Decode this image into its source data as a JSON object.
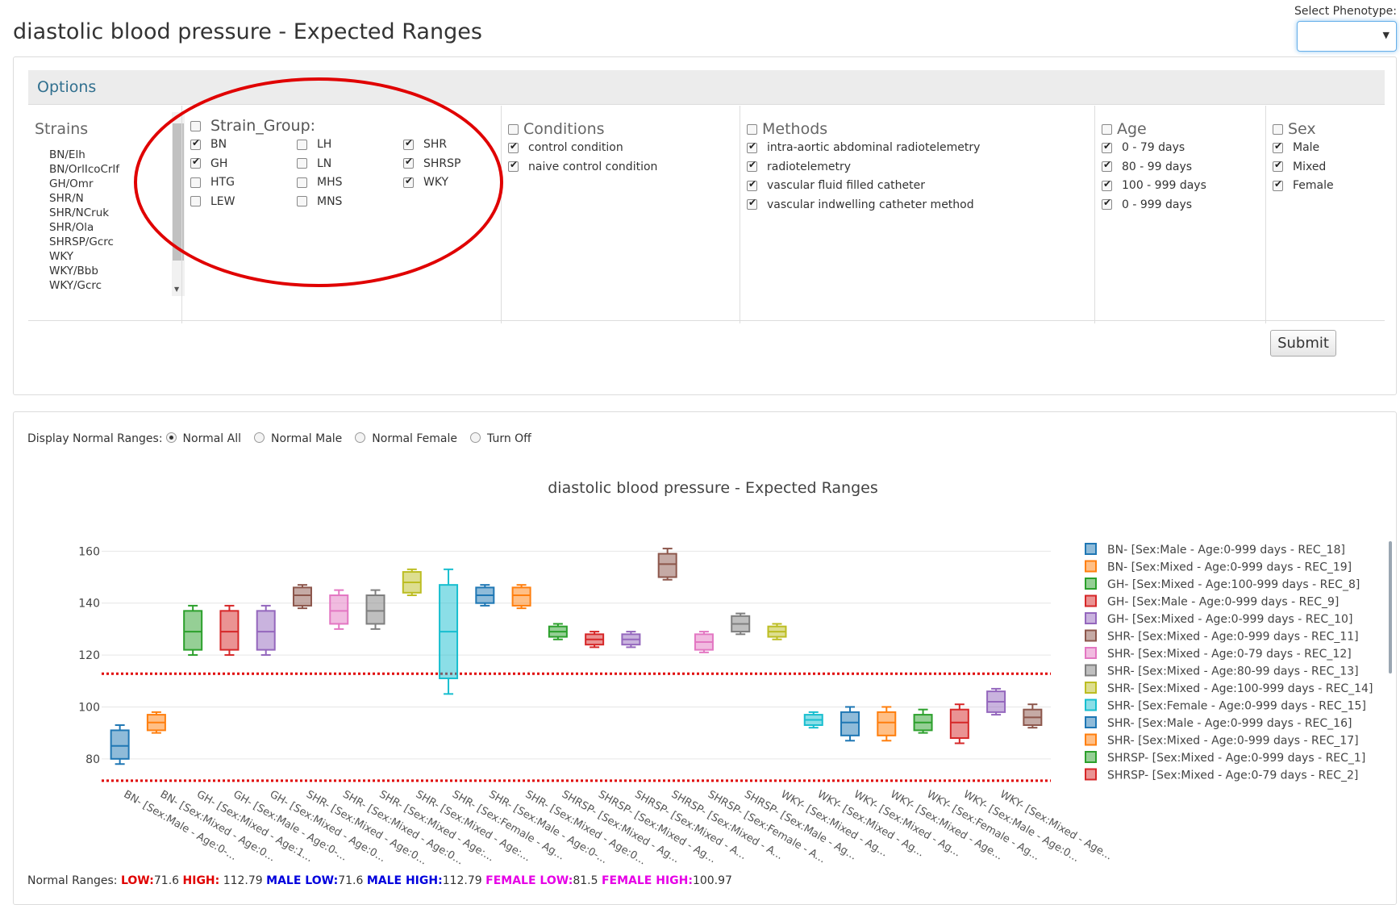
{
  "header": {
    "title": "diastolic blood pressure - Expected Ranges",
    "phenotype_label": "Select Phenotype:",
    "phenotype_value": ""
  },
  "options": {
    "title": "Options",
    "strains": {
      "title": "Strains",
      "items": [
        "BN/Elh",
        "BN/OrlIcoCrlf",
        "GH/Omr",
        "SHR/N",
        "SHR/NCruk",
        "SHR/Ola",
        "SHRSP/Gcrc",
        "WKY",
        "WKY/Bbb",
        "WKY/Gcrc"
      ]
    },
    "strain_group": {
      "title": "Strain_Group:",
      "items": [
        {
          "label": "BN",
          "checked": true
        },
        {
          "label": "GH",
          "checked": true
        },
        {
          "label": "HTG",
          "checked": false
        },
        {
          "label": "LEW",
          "checked": false
        },
        {
          "label": "LH",
          "checked": false
        },
        {
          "label": "LN",
          "checked": false
        },
        {
          "label": "MHS",
          "checked": false
        },
        {
          "label": "MNS",
          "checked": false
        },
        {
          "label": "SHR",
          "checked": true
        },
        {
          "label": "SHRSP",
          "checked": true
        },
        {
          "label": "WKY",
          "checked": true
        }
      ]
    },
    "conditions": {
      "title": "Conditions",
      "items": [
        {
          "label": "control condition",
          "checked": true
        },
        {
          "label": "naive control condition",
          "checked": true
        }
      ]
    },
    "methods": {
      "title": "Methods",
      "items": [
        {
          "label": "intra-aortic abdominal radiotelemetry",
          "checked": true
        },
        {
          "label": "radiotelemetry",
          "checked": true
        },
        {
          "label": "vascular fluid filled catheter",
          "checked": true
        },
        {
          "label": "vascular indwelling catheter method",
          "checked": true
        }
      ]
    },
    "age": {
      "title": "Age",
      "items": [
        {
          "label": "0 - 79 days",
          "checked": true
        },
        {
          "label": "80 - 99 days",
          "checked": true
        },
        {
          "label": "100 - 999 days",
          "checked": true
        },
        {
          "label": "0 - 999 days",
          "checked": true
        }
      ]
    },
    "sex": {
      "title": "Sex",
      "items": [
        {
          "label": "Male",
          "checked": true
        },
        {
          "label": "Mixed",
          "checked": true
        },
        {
          "label": "Female",
          "checked": true
        }
      ]
    },
    "submit_label": "Submit"
  },
  "display_ranges": {
    "label": "Display Normal Ranges:",
    "options": [
      "Normal All",
      "Normal Male",
      "Normal Female",
      "Turn Off"
    ],
    "selected": "Normal All"
  },
  "normal_ranges": {
    "label": "Normal Ranges:",
    "low_label": "LOW:",
    "low": "71.6",
    "high_label": "HIGH:",
    "high": "112.79",
    "male_low_label": "MALE LOW:",
    "male_low": "71.6",
    "male_high_label": "MALE HIGH:",
    "male_high": "112.79",
    "female_low_label": "FEMALE LOW:",
    "female_low": "81.5",
    "female_high_label": "FEMALE HIGH:",
    "female_high": "100.97"
  },
  "colors": {
    "blue": "#1f77b4",
    "orange": "#ff7f0e",
    "green": "#2ca02c",
    "red": "#d62728",
    "purple": "#9467bd",
    "brown": "#8c564b",
    "pink": "#e377c2",
    "gray": "#7f7f7f",
    "olive": "#bcbd22",
    "cyan": "#17becf",
    "range_line": "#e00000"
  },
  "chart_data": {
    "type": "box",
    "title": "diastolic blood pressure - Expected Ranges",
    "ylim": [
      70,
      166
    ],
    "yticks": [
      80,
      100,
      120,
      140,
      160
    ],
    "grid": true,
    "legend_position": "right",
    "reference_lines": [
      71.6,
      112.79
    ],
    "x_tick_labels": [
      "BN- [Sex:Male - Age:0-...",
      "BN- [Sex:Mixed - Age:0...",
      "GH- [Sex:Mixed - Age:1...",
      "GH- [Sex:Male - Age:0-...",
      "GH- [Sex:Mixed - Age:0...",
      "SHR- [Sex:Mixed - Age:0...",
      "SHR- [Sex:Mixed - Age:0...",
      "SHR- [Sex:Mixed - Age:...",
      "SHR- [Sex:Mixed - Age:...",
      "SHR- [Sex:Female - Ag...",
      "SHR- [Sex:Male - Age:0-...",
      "SHR- [Sex:Mixed - Age:0...",
      "SHRSP- [Sex:Mixed - Ag...",
      "SHRSP- [Sex:Mixed - Ag...",
      "SHRSP- [Sex:Mixed - A...",
      "SHRSP- [Sex:Mixed - A...",
      "SHRSP- [Sex:Female - A...",
      "SHRSP- [Sex:Male - Ag...",
      "WKY- [Sex:Mixed - Ag...",
      "WKY- [Sex:Mixed - Ag...",
      "WKY- [Sex:Mixed - Ag...",
      "WKY- [Sex:Mixed - Age...",
      "WKY- [Sex:Female - Ag...",
      "WKY- [Sex:Male - Age:0...",
      "WKY- [Sex:Mixed - Age..."
    ],
    "boxes": [
      {
        "color": "blue",
        "min": 78,
        "q1": 80,
        "median": 85,
        "q3": 91,
        "max": 93
      },
      {
        "color": "orange",
        "min": 90,
        "q1": 91,
        "median": 94,
        "q3": 97,
        "max": 98
      },
      {
        "color": "green",
        "min": 120,
        "q1": 122,
        "median": 129,
        "q3": 137,
        "max": 139
      },
      {
        "color": "red",
        "min": 120,
        "q1": 122,
        "median": 129,
        "q3": 137,
        "max": 139
      },
      {
        "color": "purple",
        "min": 120,
        "q1": 122,
        "median": 129,
        "q3": 137,
        "max": 139
      },
      {
        "color": "brown",
        "min": 138,
        "q1": 139,
        "median": 143,
        "q3": 146,
        "max": 147
      },
      {
        "color": "pink",
        "min": 130,
        "q1": 132,
        "median": 137,
        "q3": 143,
        "max": 145
      },
      {
        "color": "gray",
        "min": 130,
        "q1": 132,
        "median": 137,
        "q3": 143,
        "max": 145
      },
      {
        "color": "olive",
        "min": 143,
        "q1": 144,
        "median": 148,
        "q3": 152,
        "max": 153
      },
      {
        "color": "cyan",
        "min": 105,
        "q1": 111,
        "median": 129,
        "q3": 147,
        "max": 153
      },
      {
        "color": "blue",
        "min": 139,
        "q1": 140,
        "median": 143,
        "q3": 146,
        "max": 147
      },
      {
        "color": "orange",
        "min": 138,
        "q1": 139,
        "median": 143,
        "q3": 146,
        "max": 147
      },
      {
        "color": "green",
        "min": 126,
        "q1": 127,
        "median": 129,
        "q3": 131,
        "max": 132
      },
      {
        "color": "red",
        "min": 123,
        "q1": 124,
        "median": 126,
        "q3": 128,
        "max": 129
      },
      {
        "color": "purple",
        "min": 123,
        "q1": 124,
        "median": 126,
        "q3": 128,
        "max": 129
      },
      {
        "color": "brown",
        "min": 149,
        "q1": 150,
        "median": 155,
        "q3": 159,
        "max": 161
      },
      {
        "color": "pink",
        "min": 121,
        "q1": 122,
        "median": 125,
        "q3": 128,
        "max": 129
      },
      {
        "color": "gray",
        "min": 128,
        "q1": 129,
        "median": 132,
        "q3": 135,
        "max": 136
      },
      {
        "color": "olive",
        "min": 126,
        "q1": 127,
        "median": 129,
        "q3": 131,
        "max": 132
      },
      {
        "color": "cyan",
        "min": 92,
        "q1": 93,
        "median": 95,
        "q3": 97,
        "max": 98
      },
      {
        "color": "blue",
        "min": 87,
        "q1": 89,
        "median": 94,
        "q3": 98,
        "max": 100
      },
      {
        "color": "orange",
        "min": 87,
        "q1": 89,
        "median": 94,
        "q3": 98,
        "max": 100
      },
      {
        "color": "green",
        "min": 90,
        "q1": 91,
        "median": 94,
        "q3": 97,
        "max": 99
      },
      {
        "color": "red",
        "min": 86,
        "q1": 88,
        "median": 94,
        "q3": 99,
        "max": 101
      },
      {
        "color": "purple",
        "min": 97,
        "q1": 98,
        "median": 102,
        "q3": 106,
        "max": 107
      },
      {
        "color": "brown",
        "min": 92,
        "q1": 93,
        "median": 96,
        "q3": 99,
        "max": 101
      }
    ],
    "legend": [
      {
        "label": "BN- [Sex:Male - Age:0-999 days - REC_18]",
        "color": "blue"
      },
      {
        "label": "BN- [Sex:Mixed - Age:0-999 days - REC_19]",
        "color": "orange"
      },
      {
        "label": "GH- [Sex:Mixed - Age:100-999 days - REC_8]",
        "color": "green"
      },
      {
        "label": "GH- [Sex:Male - Age:0-999 days - REC_9]",
        "color": "red"
      },
      {
        "label": "GH- [Sex:Mixed - Age:0-999 days - REC_10]",
        "color": "purple"
      },
      {
        "label": "SHR- [Sex:Mixed - Age:0-999 days - REC_11]",
        "color": "brown"
      },
      {
        "label": "SHR- [Sex:Mixed - Age:0-79 days - REC_12]",
        "color": "pink"
      },
      {
        "label": "SHR- [Sex:Mixed - Age:80-99 days - REC_13]",
        "color": "gray"
      },
      {
        "label": "SHR- [Sex:Mixed - Age:100-999 days - REC_14]",
        "color": "olive"
      },
      {
        "label": "SHR- [Sex:Female - Age:0-999 days - REC_15]",
        "color": "cyan"
      },
      {
        "label": "SHR- [Sex:Male - Age:0-999 days - REC_16]",
        "color": "blue"
      },
      {
        "label": "SHR- [Sex:Mixed - Age:0-999 days - REC_17]",
        "color": "orange"
      },
      {
        "label": "SHRSP- [Sex:Mixed - Age:0-999 days - REC_1]",
        "color": "green"
      },
      {
        "label": "SHRSP- [Sex:Mixed - Age:0-79 days - REC_2]",
        "color": "red"
      }
    ]
  }
}
